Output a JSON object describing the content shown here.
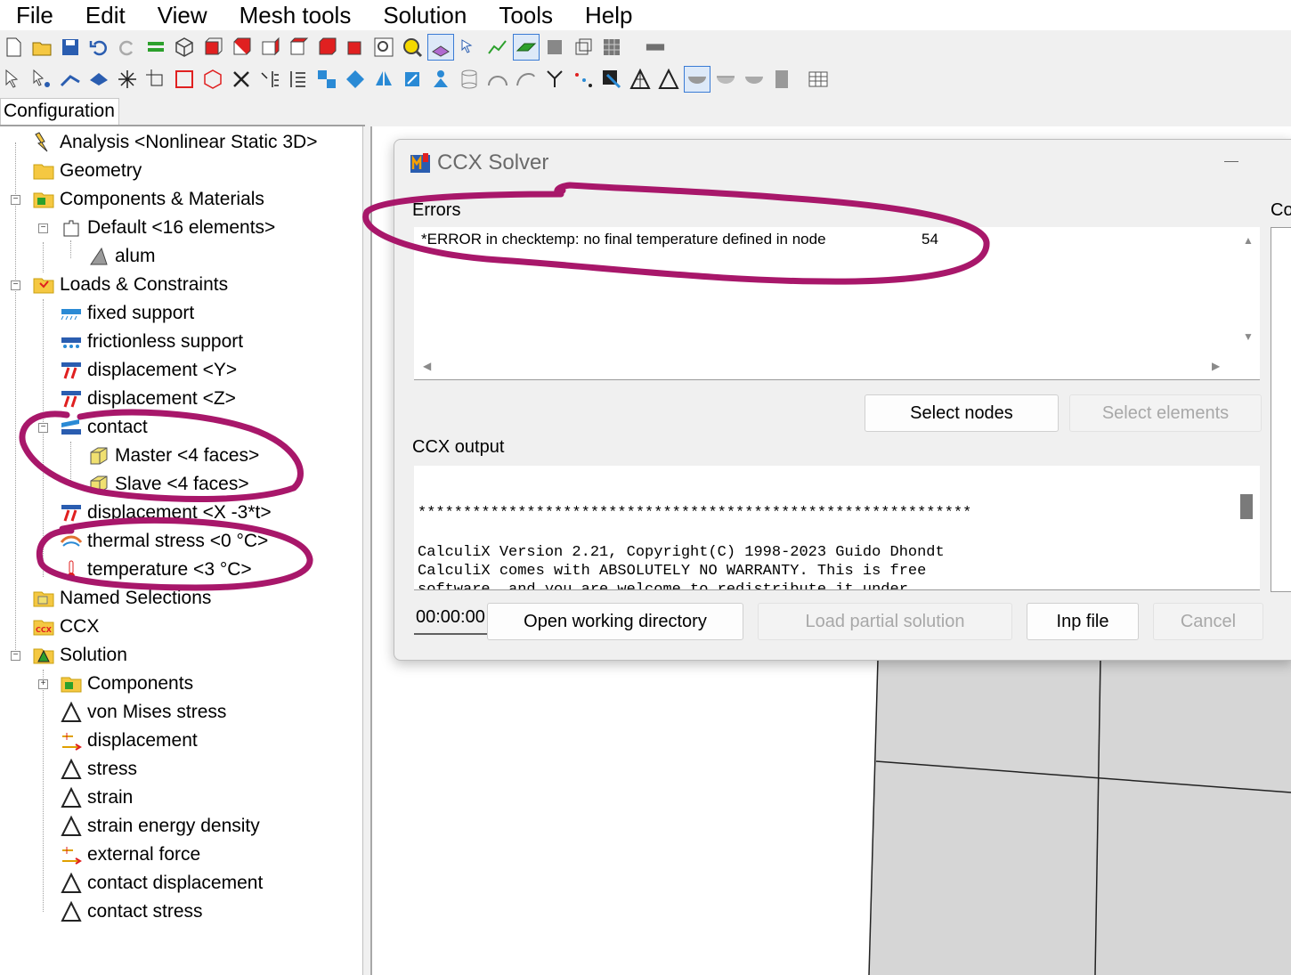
{
  "menu": [
    "File",
    "Edit",
    "View",
    "Mesh tools",
    "Solution",
    "Tools",
    "Help"
  ],
  "config_tab": "Configuration",
  "tree": {
    "analysis": "Analysis <Nonlinear Static 3D>",
    "geometry": "Geometry",
    "components_materials": "Components & Materials",
    "default": "Default <16 elements>",
    "alum": "alum",
    "loads": "Loads & Constraints",
    "fixed_support": "fixed support",
    "frictionless_support": "frictionless support",
    "displacement_y": "displacement <Y>",
    "displacement_z": "displacement <Z>",
    "contact": "contact",
    "master": "Master <4 faces>",
    "slave": "Slave <4 faces>",
    "displacement_x": "displacement <X -3*t>",
    "thermal_stress": "thermal stress <0 °C>",
    "temperature": "temperature <3 °C>",
    "named_selections": "Named Selections",
    "ccx": "CCX",
    "solution": "Solution",
    "components": "Components",
    "von_mises": "von Mises stress",
    "displacement": "displacement",
    "stress": "stress",
    "strain": "strain",
    "strain_energy": "strain energy density",
    "external_force": "external force",
    "contact_displacement": "contact displacement",
    "contact_stress": "contact stress"
  },
  "dialog": {
    "title": "CCX Solver",
    "errors_label": "Errors",
    "error_text": "*ERROR in checktemp: no final temperature defined in node",
    "error_node": "54",
    "select_nodes": "Select nodes",
    "select_elements": "Select elements",
    "output_label": "CCX output",
    "output_lines": [
      "",
      "*************************************************************",
      "",
      "CalculiX Version 2.21, Copyright(C) 1998-2023 Guido Dhondt",
      "CalculiX comes with ABSOLUTELY NO WARRANTY. This is free",
      "software, and you are welcome to redistribute it under"
    ],
    "timer": "00:00:00",
    "open_dir": "Open working directory",
    "load_partial": "Load partial solution",
    "inp_file": "Inp file",
    "cancel": "Cancel",
    "side_label": "Co"
  },
  "colors": {
    "annotation": "#a8176a",
    "disabled_text": "#a8a8a8",
    "folder": "#f5c842"
  }
}
